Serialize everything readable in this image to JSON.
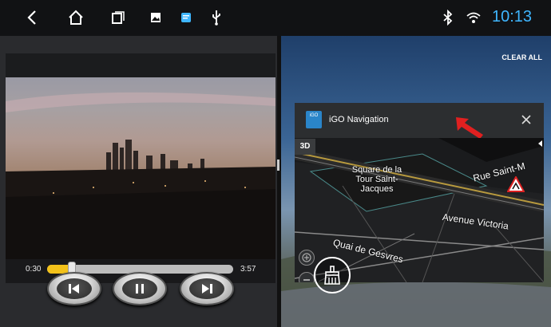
{
  "status_bar": {
    "clock": "10:13",
    "icons": [
      "back-icon",
      "home-icon",
      "recent-apps-icon",
      "gallery-icon",
      "notification-icon",
      "usb-icon",
      "bluetooth-icon",
      "wifi-icon"
    ]
  },
  "player": {
    "elapsed": "0:30",
    "duration": "3:57",
    "progress": 0.13,
    "controls": [
      "previous",
      "pause",
      "next"
    ]
  },
  "recents": {
    "clear_all": "CLEAR ALL",
    "card": {
      "app_name": "iGO Navigation",
      "app_logo_text": "iGO",
      "map_mode": "3D",
      "streets": [
        "Square de la Tour Saint-Jacques",
        "Rue Saint-M",
        "Avenue Victoria",
        "Quai de Gesvres"
      ]
    }
  },
  "colors": {
    "accent": "#3fb6ff",
    "progress": "#f3c21a",
    "marker": "#e02020"
  }
}
